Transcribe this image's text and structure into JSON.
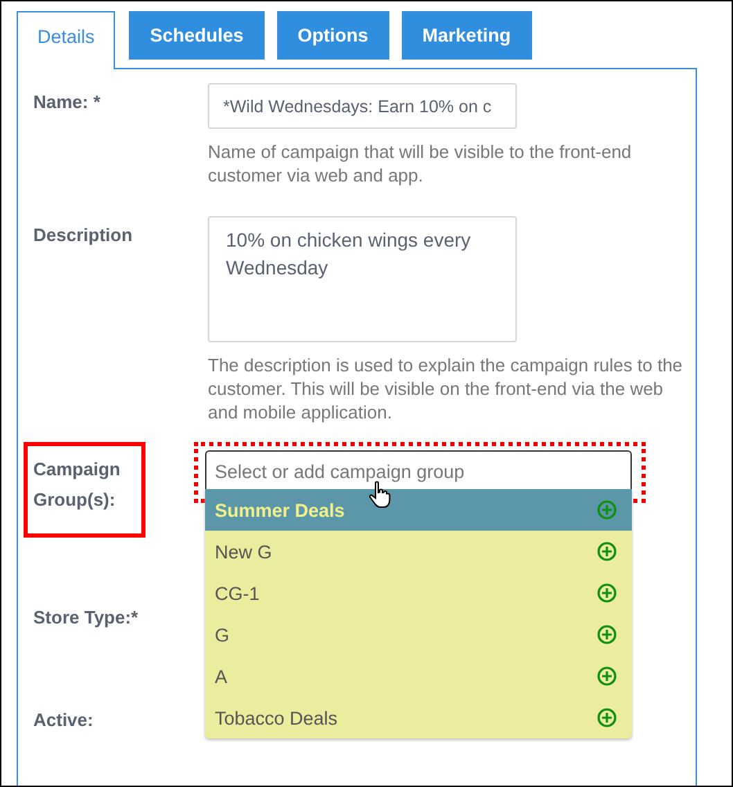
{
  "tabs": [
    {
      "label": "Details",
      "selected": true
    },
    {
      "label": "Schedules",
      "selected": false
    },
    {
      "label": "Options",
      "selected": false
    },
    {
      "label": "Marketing",
      "selected": false
    }
  ],
  "form": {
    "name": {
      "label": "Name: *",
      "value": "*Wild Wednesdays: Earn 10% on c",
      "help": "Name of campaign that will be visible to the front-end customer via web and app."
    },
    "description": {
      "label": "Description",
      "value": "10% on chicken wings every Wednesday",
      "help": "The description is used to explain the campaign rules to the customer. This will be visible on the front-end via the web and mobile application."
    },
    "campaign_groups": {
      "label": "Campaign Group(s):",
      "placeholder": "Select or add campaign group",
      "expanded": true,
      "options": [
        {
          "label": "Summer Deals",
          "selected": true
        },
        {
          "label": "New G",
          "selected": false
        },
        {
          "label": "CG-1",
          "selected": false
        },
        {
          "label": "G",
          "selected": false
        },
        {
          "label": "A",
          "selected": false
        },
        {
          "label": "Tobacco Deals",
          "selected": false
        }
      ]
    },
    "store_type": {
      "label": "Store Type:*"
    },
    "active": {
      "label": "Active:"
    }
  }
}
